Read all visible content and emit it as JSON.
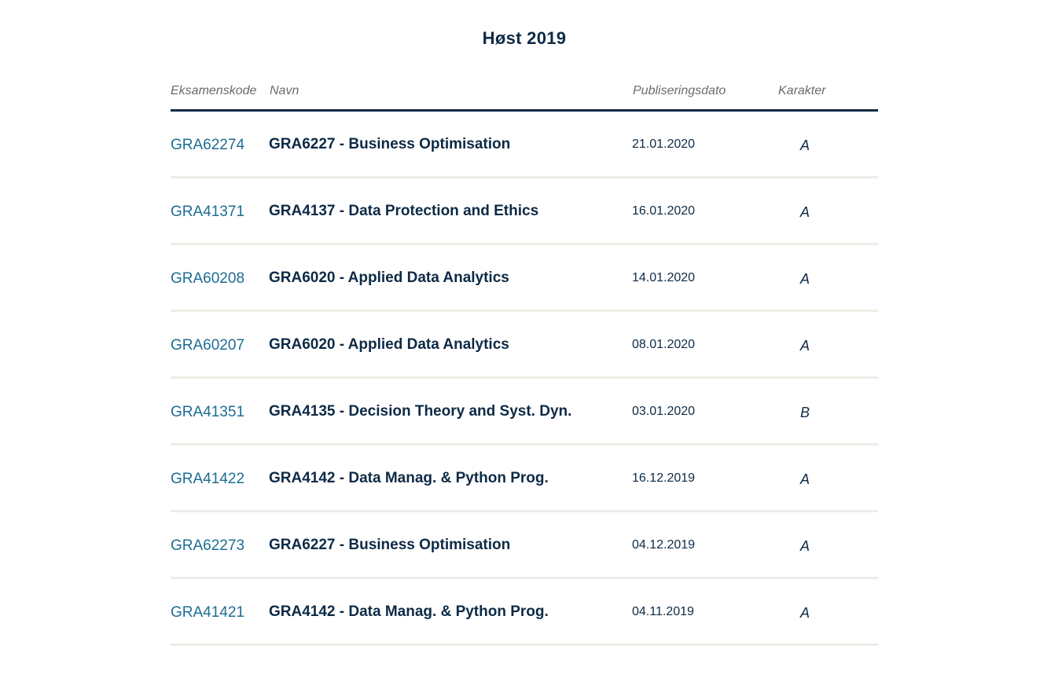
{
  "semester": {
    "title": "Høst 2019"
  },
  "table": {
    "headers": {
      "code": "Eksamenskode",
      "name": "Navn",
      "date": "Publiseringsdato",
      "grade": "Karakter"
    },
    "rows": [
      {
        "code": "GRA62274",
        "name": "GRA6227 - Business Optimisation",
        "date": "21.01.2020",
        "grade": "A"
      },
      {
        "code": "GRA41371",
        "name": "GRA4137 - Data Protection and Ethics",
        "date": "16.01.2020",
        "grade": "A"
      },
      {
        "code": "GRA60208",
        "name": "GRA6020 - Applied Data Analytics",
        "date": "14.01.2020",
        "grade": "A"
      },
      {
        "code": "GRA60207",
        "name": "GRA6020 - Applied Data Analytics",
        "date": "08.01.2020",
        "grade": "A"
      },
      {
        "code": "GRA41351",
        "name": "GRA4135 - Decision Theory and Syst. Dyn.",
        "date": "03.01.2020",
        "grade": "B"
      },
      {
        "code": "GRA41422",
        "name": "GRA4142 - Data Manag. & Python Prog.",
        "date": "16.12.2019",
        "grade": "A"
      },
      {
        "code": "GRA62273",
        "name": "GRA6227 - Business Optimisation",
        "date": "04.12.2019",
        "grade": "A"
      },
      {
        "code": "GRA41421",
        "name": "GRA4142 - Data Manag. & Python Prog.",
        "date": "04.11.2019",
        "grade": "A"
      }
    ]
  }
}
